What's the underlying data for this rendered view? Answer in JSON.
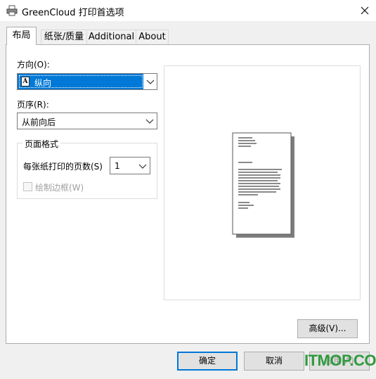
{
  "window": {
    "title": "GreenCloud 打印首选项",
    "icon": "printer-icon",
    "close_icon": "close-icon"
  },
  "tabs": [
    {
      "label": "布局",
      "active": true
    },
    {
      "label": "纸张/质量",
      "active": false
    },
    {
      "label": "Additional",
      "active": false
    },
    {
      "label": "About",
      "active": false
    }
  ],
  "orientation": {
    "label": "方向(O):",
    "selected": "纵向",
    "icon": "A"
  },
  "page_order": {
    "label": "页序(R):",
    "selected": "从前向后"
  },
  "page_format": {
    "title": "页面格式",
    "pages_per_sheet_label": "每张纸打印的页数(S)",
    "pages_per_sheet_value": "1",
    "draw_borders_label": "绘制边框(W)",
    "draw_borders_checked": false
  },
  "buttons": {
    "advanced": "高级(V)...",
    "ok": "确定",
    "cancel": "取消",
    "apply": "应用(A)"
  },
  "watermark": "ITMOP.COM",
  "colors": {
    "accent": "#0078d7",
    "watermark": "#2f9a3e"
  }
}
